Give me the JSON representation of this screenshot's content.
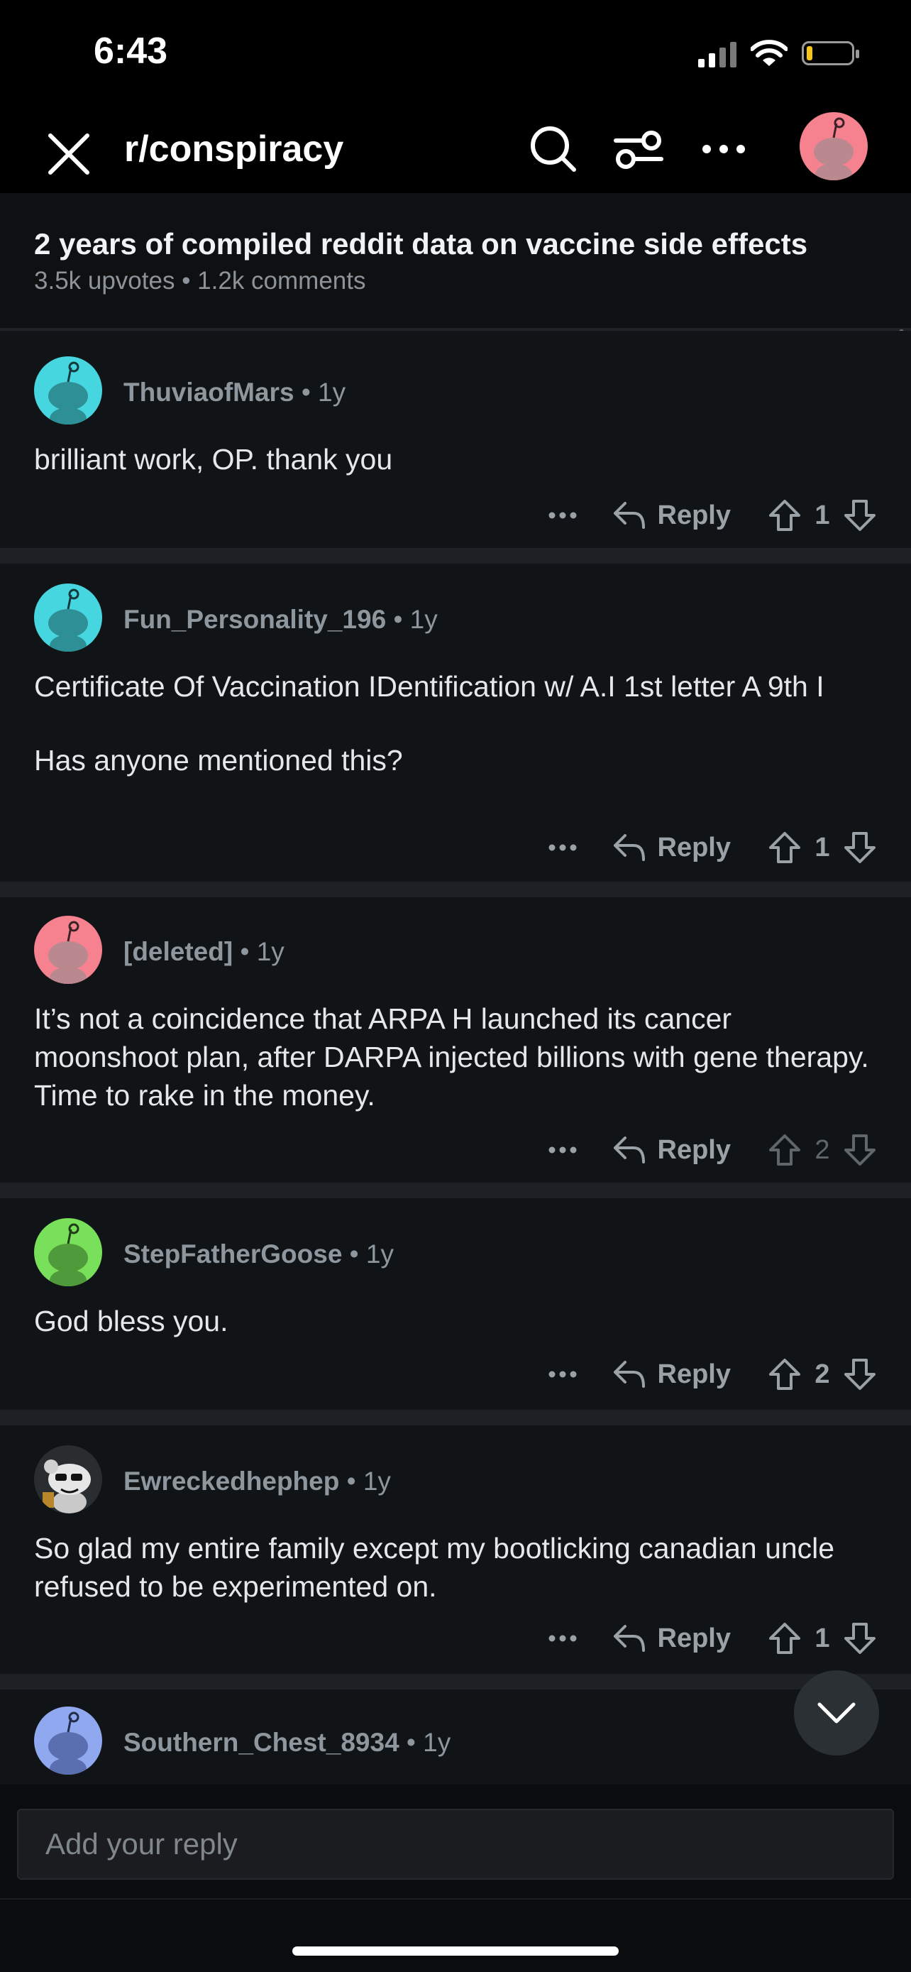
{
  "status_bar": {
    "time": "6:43"
  },
  "nav": {
    "subreddit": "r/conspiracy"
  },
  "post": {
    "title": "2 years of compiled reddit data on vaccine side effects",
    "meta": "3.5k upvotes • 1.2k comments"
  },
  "comments": [
    {
      "author": "ThuviaofMars",
      "age": " • 1y",
      "body": [
        "brilliant work, OP. thank you"
      ],
      "reply_label": "Reply",
      "votes": "1",
      "avatar_color": "#46d6e0"
    },
    {
      "author": "Fun_Personality_196",
      "age": " • 1y",
      "body": [
        "Certificate Of Vaccination IDentification w/ A.I 1st letter A 9th I",
        "Has anyone mentioned this?"
      ],
      "reply_label": "Reply",
      "votes": "1",
      "avatar_color": "#46d6e0"
    },
    {
      "author": "[deleted]",
      "age": " • 1y",
      "body": [
        "It’s not a coincidence that ARPA H launched its cancer moonshoot plan, after DARPA injected billions with gene therapy. Time to rake in the money."
      ],
      "reply_label": "Reply",
      "votes": "2",
      "avatar_color": "#f7828f"
    },
    {
      "author": "StepFatherGoose",
      "age": " • 1y",
      "body": [
        "God bless you."
      ],
      "reply_label": "Reply",
      "votes": "2",
      "avatar_color": "#78e05a"
    },
    {
      "author": "Ewreckedhephep",
      "age": " • 1y",
      "body": [
        "So glad my entire family except my bootlicking canadian uncle refused to be experimented on."
      ],
      "reply_label": "Reply",
      "votes": "1",
      "avatar_color": "#2a2d30"
    },
    {
      "author": "Southern_Chest_8934",
      "age": " • 1y",
      "body": [],
      "avatar_color": "#8fa8f0"
    }
  ],
  "reply_box": {
    "placeholder": "Add your reply"
  }
}
